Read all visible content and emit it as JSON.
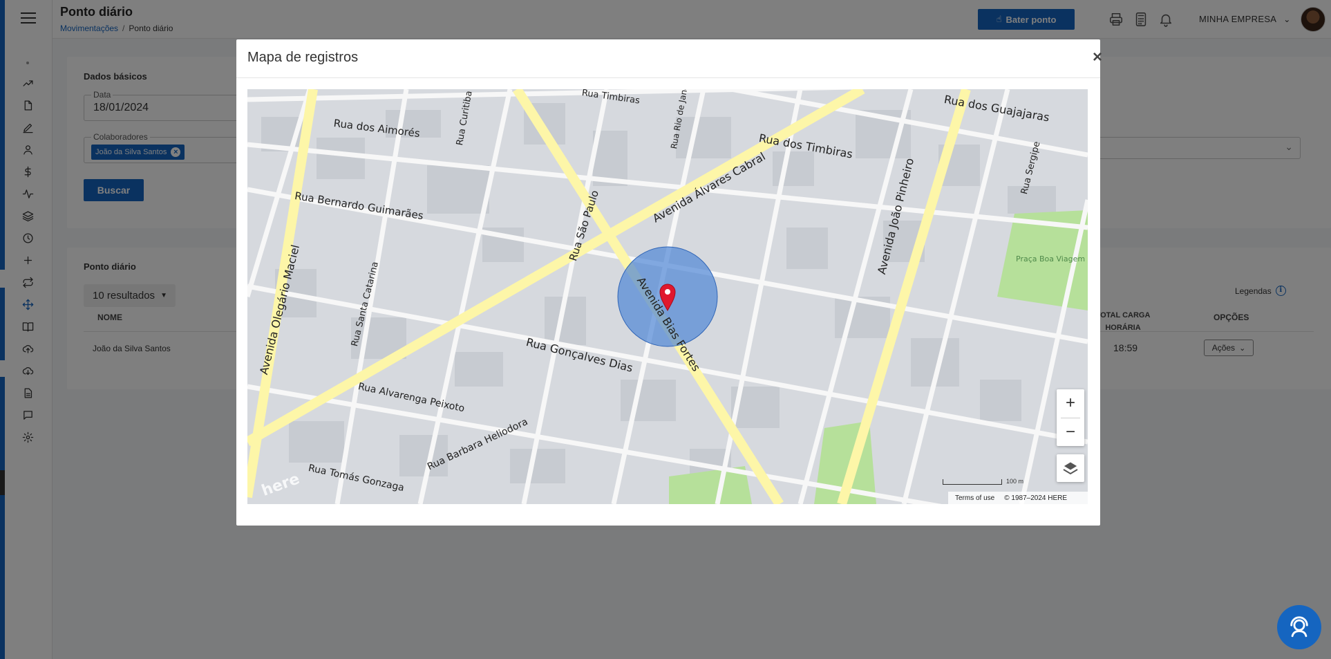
{
  "header": {
    "page_title": "Ponto diário",
    "breadcrumb_link": "Movimentações",
    "breadcrumb_sep": "/",
    "breadcrumb_current": "Ponto diário",
    "bater_ponto_label": "Bater ponto",
    "company_name": "MINHA EMPRESA"
  },
  "filters": {
    "section_title": "Dados básicos",
    "date_label": "Data",
    "date_value": "18/01/2024",
    "colaboradores_label": "Colaboradores",
    "colaborador_chip": "João da Silva Santos",
    "search_button": "Buscar"
  },
  "results": {
    "section_title": "Ponto diário",
    "page_size": "10 resultados",
    "legend_label": "Legendas",
    "columns": {
      "nome": "NOME",
      "total_carga_line1": "TOTAL CARGA",
      "total_carga_line2": "HORÁRIA",
      "opcoes": "OPÇÕES"
    },
    "rows": [
      {
        "nome": "João da Silva Santos",
        "total": "18:59",
        "acoes": "Ações"
      }
    ]
  },
  "modal": {
    "title": "Mapa de registros",
    "close": "×",
    "map": {
      "zoom_in": "+",
      "zoom_out": "−",
      "scale": "100 m",
      "terms": "Terms of use",
      "copyright": "© 1987–2024 HERE",
      "logo": "here",
      "street_labels": [
        "Rua dos Aimorés",
        "Avenida Olegário Maciel",
        "Rua Bernardo Guimarães",
        "Rua Curitiba",
        "Rua São Paulo",
        "Rua Timbiras",
        "Rua Rio de Janeiro",
        "Avenida Álvares Cabral",
        "Rua dos Timbiras",
        "Rua dos Guajajaras",
        "Avenida João Pinheiro",
        "Rua Sergipe",
        "Praça Boa Viagem",
        "Rua Santa Catarina",
        "Rua Gonçalves Dias",
        "Avenida Bias Fortes",
        "Rua Alvarenga Peixoto",
        "Rua Barbara Heliodora",
        "Rua Tomás Gonzaga"
      ]
    }
  },
  "colors": {
    "primary": "#1565c0",
    "marker": "#e0182e",
    "circle": "#4f86d6",
    "park": "#b6e09a",
    "avenue": "#fdf6a8"
  }
}
